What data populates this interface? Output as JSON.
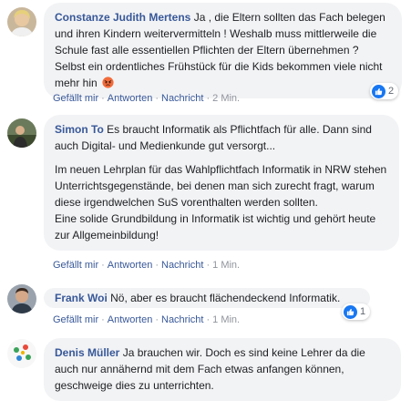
{
  "actions": {
    "like": "Gefällt mir",
    "reply": "Antworten",
    "message": "Nachricht",
    "separator": "·"
  },
  "comments": [
    {
      "author": "Constanze Judith Mertens",
      "text": "Ja , die Eltern sollten das Fach belegen und ihren Kindern weitervermitteln ! Weshalb muss mittlerweile die Schule fast alle essentiellen Pflichten der Eltern übernehmen ? Selbst ein ordentliches Frühstück für die Kids bekommen viele nicht mehr hin",
      "emoji": "angry-face-icon",
      "time": "2 Min.",
      "reactions": "2",
      "reaction_icon": "like-icon"
    },
    {
      "author": "Simon To",
      "text": "Es braucht Informatik als Pflichtfach für alle. Dann sind auch Digital- und Medienkunde gut versorgt...",
      "text2": "Im neuen Lehrplan für das Wahlpflichtfach Informatik in NRW stehen Unterrichtsgegenstände, bei denen man sich zurecht fragt, warum diese irgendwelchen SuS vorenthalten werden sollten.\nEine solide Grundbildung in Informatik ist wichtig und gehört heute zur Allgemeinbildung!",
      "time": "1 Min."
    },
    {
      "author": "Frank Woi",
      "text": "Nö, aber es braucht flächendeckend Informatik.",
      "time": "1 Min.",
      "reactions": "1",
      "reaction_icon": "like-icon"
    },
    {
      "author": "Denis Müller",
      "text": "Ja brauchen wir. Doch es sind keine Lehrer da die auch nur annähernd mit dem Fach etwas anfangen können, geschweige dies zu unterrichten."
    }
  ],
  "colors": {
    "author": "#385898",
    "bubble": "#f2f3f5",
    "action_link": "#385898",
    "time": "#90949c",
    "like_badge": "#1877f2"
  }
}
